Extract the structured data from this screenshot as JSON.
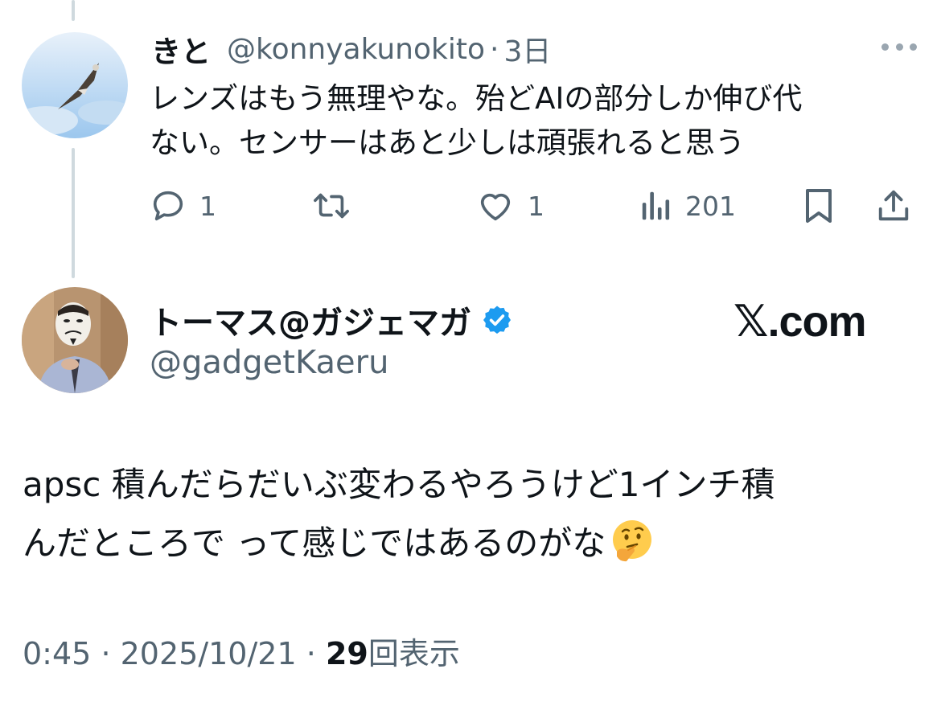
{
  "parent_post": {
    "display_name": "きと",
    "handle": "@konnyakunokito",
    "separator": "·",
    "time_ago": "3日",
    "text_line1": "レンズはもう無理やな。殆どAIの部分しか伸び代",
    "text_line2": "ない。センサーはあと少しは頑張れると思う",
    "reply_count": "1",
    "like_count": "1",
    "view_count": "201"
  },
  "main_post": {
    "display_name": "トーマス@ガジェマガ",
    "handle": "@gadgetKaeru",
    "verified": true,
    "text_line1": "apsc 積んだらだいぶ変わるやろうけど1インチ積",
    "text_line2": "んだところで って感じではあるのがな",
    "emoji": "thinking-face",
    "time": "0:45",
    "separator": "·",
    "date": "2025/10/21",
    "views": "29",
    "views_label": "回表示"
  },
  "watermark": "𝕏.com",
  "colors": {
    "text_primary": "#0f1419",
    "text_secondary": "#536471",
    "verified_blue": "#1d9bf0",
    "thread_line": "#cfd9de"
  },
  "icons": [
    "reply-icon",
    "repost-icon",
    "like-icon",
    "views-icon",
    "bookmark-icon",
    "share-icon",
    "more-icon",
    "verified-badge-icon",
    "thinking-face-emoji"
  ]
}
